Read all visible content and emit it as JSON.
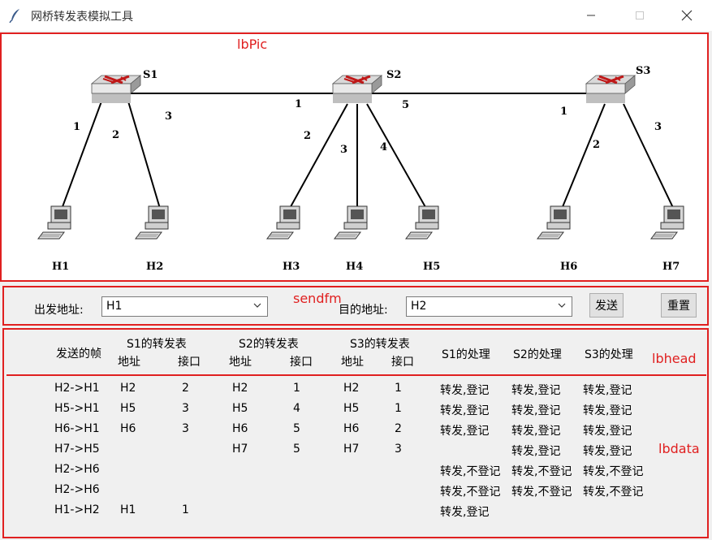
{
  "window": {
    "title": "网桥转发表模拟工具"
  },
  "frame_labels": {
    "pic": "lbPic",
    "send": "sendfm",
    "head": "lbhead",
    "data": "lbdata"
  },
  "diagram": {
    "switches": [
      "S1",
      "S2",
      "S3"
    ],
    "hosts": [
      "H1",
      "H2",
      "H3",
      "H4",
      "H5",
      "H6",
      "H7"
    ],
    "ports": {
      "s1_h1": "1",
      "s1_h2": "2",
      "s1_s2": "3",
      "s2_s1": "1",
      "s2_h3": "2",
      "s2_h4": "3",
      "s2_h5": "4",
      "s2_s3": "5",
      "s3_s2": "1",
      "s3_h6": "2",
      "s3_h7": "3"
    }
  },
  "send_form": {
    "src_label": "出发地址:",
    "src_value": "H1",
    "dst_label": "目的地址:",
    "dst_value": "H2",
    "send_button": "发送",
    "reset_button": "重置"
  },
  "table": {
    "headers": {
      "frame": "发送的帧",
      "s1_table": "S1的转发表",
      "s2_table": "S2的转发表",
      "s3_table": "S3的转发表",
      "addr": "地址",
      "port": "接口",
      "s1_proc": "S1的处理",
      "s2_proc": "S2的处理",
      "s3_proc": "S3的处理"
    },
    "rows": [
      {
        "frame": "H2->H1",
        "s1_addr": "H2",
        "s1_port": "2",
        "s2_addr": "H2",
        "s2_port": "1",
        "s3_addr": "H2",
        "s3_port": "1",
        "s1_proc": "转发,登记",
        "s2_proc": "转发,登记",
        "s3_proc": "转发,登记"
      },
      {
        "frame": "H5->H1",
        "s1_addr": "H5",
        "s1_port": "3",
        "s2_addr": "H5",
        "s2_port": "4",
        "s3_addr": "H5",
        "s3_port": "1",
        "s1_proc": "转发,登记",
        "s2_proc": "转发,登记",
        "s3_proc": "转发,登记"
      },
      {
        "frame": "H6->H1",
        "s1_addr": "H6",
        "s1_port": "3",
        "s2_addr": "H6",
        "s2_port": "5",
        "s3_addr": "H6",
        "s3_port": "2",
        "s1_proc": "转发,登记",
        "s2_proc": "转发,登记",
        "s3_proc": "转发,登记"
      },
      {
        "frame": "H7->H5",
        "s1_addr": "",
        "s1_port": "",
        "s2_addr": "H7",
        "s2_port": "5",
        "s3_addr": "H7",
        "s3_port": "3",
        "s1_proc": "",
        "s2_proc": "转发,登记",
        "s3_proc": "转发,登记"
      },
      {
        "frame": "H2->H6",
        "s1_addr": "",
        "s1_port": "",
        "s2_addr": "",
        "s2_port": "",
        "s3_addr": "",
        "s3_port": "",
        "s1_proc": "转发,不登记",
        "s2_proc": "转发,不登记",
        "s3_proc": "转发,不登记"
      },
      {
        "frame": "H2->H6",
        "s1_addr": "",
        "s1_port": "",
        "s2_addr": "",
        "s2_port": "",
        "s3_addr": "",
        "s3_port": "",
        "s1_proc": "转发,不登记",
        "s2_proc": "转发,不登记",
        "s3_proc": "转发,不登记"
      },
      {
        "frame": "H1->H2",
        "s1_addr": "H1",
        "s1_port": "1",
        "s2_addr": "",
        "s2_port": "",
        "s3_addr": "",
        "s3_port": "",
        "s1_proc": "转发,登记",
        "s2_proc": "",
        "s3_proc": ""
      }
    ]
  },
  "colors": {
    "frame_border": "#e02020",
    "panel_bg": "#f0f0f0"
  },
  "icons": {
    "app": "feather-icon",
    "minimize": "minimize-icon",
    "maximize": "maximize-icon",
    "close": "close-icon",
    "dropdown": "chevron-down-icon"
  }
}
